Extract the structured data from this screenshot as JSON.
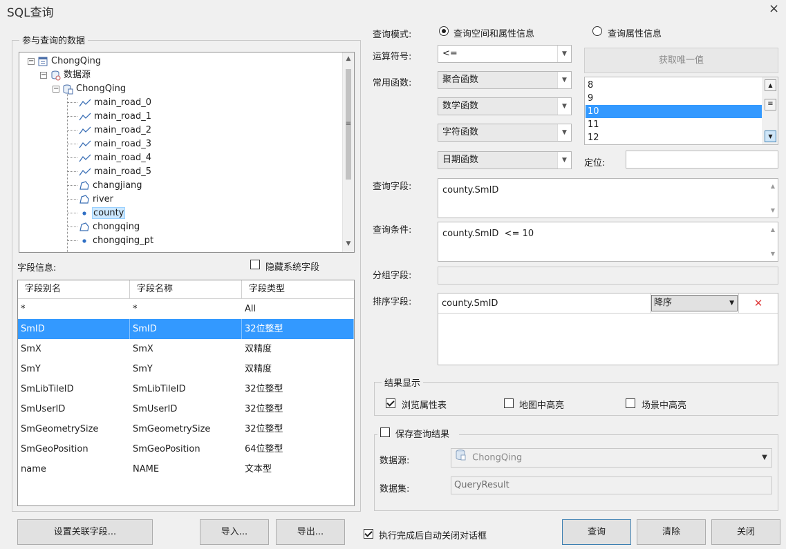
{
  "window": {
    "title": "SQL查询",
    "close_glyph": "×"
  },
  "left": {
    "datasets_group_label": "参与查询的数据",
    "tree": [
      {
        "label": "ChongQing",
        "icon": "workspace-icon",
        "level": 0
      },
      {
        "label": "数据源",
        "icon": "datasources-icon",
        "level": 1
      },
      {
        "label": "ChongQing",
        "icon": "datasource-icon",
        "level": 2
      },
      {
        "label": "main_road_0",
        "icon": "line-dataset-icon",
        "level": 3
      },
      {
        "label": "main_road_1",
        "icon": "line-dataset-icon",
        "level": 3
      },
      {
        "label": "main_road_2",
        "icon": "line-dataset-icon",
        "level": 3
      },
      {
        "label": "main_road_3",
        "icon": "line-dataset-icon",
        "level": 3
      },
      {
        "label": "main_road_4",
        "icon": "line-dataset-icon",
        "level": 3
      },
      {
        "label": "main_road_5",
        "icon": "line-dataset-icon",
        "level": 3
      },
      {
        "label": "changjiang",
        "icon": "region-dataset-icon",
        "level": 3
      },
      {
        "label": "river",
        "icon": "region-dataset-icon",
        "level": 3
      },
      {
        "label": "county",
        "icon": "point-dataset-icon",
        "level": 3,
        "selected": true
      },
      {
        "label": "chongqing",
        "icon": "region-dataset-icon",
        "level": 3
      },
      {
        "label": "chongqing_pt",
        "icon": "point-dataset-icon",
        "level": 3
      }
    ],
    "field_info_label": "字段信息:",
    "hide_system_fields_label": "隐藏系统字段",
    "hide_system_fields_checked": false,
    "field_columns": [
      "字段别名",
      "字段名称",
      "字段类型"
    ],
    "fields": [
      {
        "alias": "*",
        "name": "*",
        "type": "All"
      },
      {
        "alias": "SmID",
        "name": "SmID",
        "type": "32位整型",
        "selected": true
      },
      {
        "alias": "SmX",
        "name": "SmX",
        "type": "双精度"
      },
      {
        "alias": "SmY",
        "name": "SmY",
        "type": "双精度"
      },
      {
        "alias": "SmLibTileID",
        "name": "SmLibTileID",
        "type": "32位整型"
      },
      {
        "alias": "SmUserID",
        "name": "SmUserID",
        "type": "32位整型"
      },
      {
        "alias": "SmGeometrySize",
        "name": "SmGeometrySize",
        "type": "32位整型"
      },
      {
        "alias": "SmGeoPosition",
        "name": "SmGeoPosition",
        "type": "64位整型"
      },
      {
        "alias": "name",
        "name": "NAME",
        "type": "文本型"
      }
    ]
  },
  "right": {
    "query_mode_label": "查询模式:",
    "mode_spatial_label": "查询空间和属性信息",
    "mode_attr_label": "查询属性信息",
    "mode_selected": "spatial",
    "operator_label": "运算符号:",
    "operator_value": "<=",
    "get_unique_label": "获取唯一值",
    "functions_label": "常用函数:",
    "functions": [
      "聚合函数",
      "数学函数",
      "字符函数",
      "日期函数"
    ],
    "unique_values": [
      "8",
      "9",
      "10",
      "11",
      "12"
    ],
    "unique_selected": "10",
    "locate_label": "定位:",
    "locate_value": "",
    "query_field_label": "查询字段:",
    "query_field_value": "county.SmID",
    "query_condition_label": "查询条件:",
    "query_condition_value": "county.SmID  <= 10",
    "group_field_label": "分组字段:",
    "group_field_value": "",
    "sort_field_label": "排序字段:",
    "sort_field_value": "county.SmID",
    "sort_order_value": "降序",
    "result_display_label": "结果显示",
    "browse_table_label": "浏览属性表",
    "browse_table_checked": true,
    "highlight_map_label": "地图中高亮",
    "highlight_map_checked": false,
    "highlight_scene_label": "场景中高亮",
    "highlight_scene_checked": false,
    "save_result_label": "保存查询结果",
    "save_result_checked": false,
    "datasource_label": "数据源:",
    "datasource_value": "ChongQing",
    "dataset_label": "数据集:",
    "dataset_value": "QueryResult"
  },
  "footer": {
    "set_join_label": "设置关联字段...",
    "import_label": "导入...",
    "export_label": "导出...",
    "auto_close_label": "执行完成后自动关闭对话框",
    "auto_close_checked": true,
    "query_label": "查询",
    "clear_label": "清除",
    "close_label": "关闭"
  },
  "colors": {
    "selection": "#3399ff",
    "tree_selection": "#cce8ff",
    "delete": "#e04040"
  }
}
